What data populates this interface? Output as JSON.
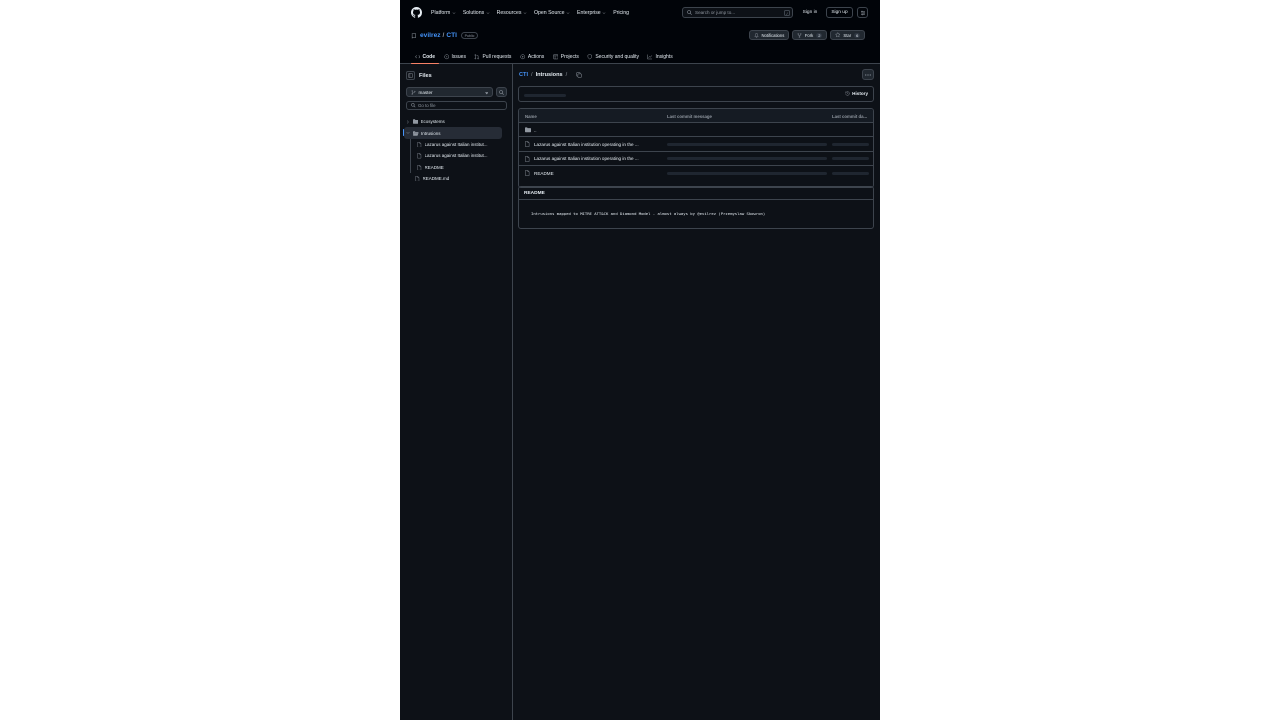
{
  "header": {
    "nav": [
      {
        "label": "Platform",
        "has_menu": true
      },
      {
        "label": "Solutions",
        "has_menu": true
      },
      {
        "label": "Resources",
        "has_menu": true
      },
      {
        "label": "Open Source",
        "has_menu": true
      },
      {
        "label": "Enterprise",
        "has_menu": true
      },
      {
        "label": "Pricing",
        "has_menu": false
      }
    ],
    "search_placeholder": "Search or jump to...",
    "search_shortcut": "/",
    "sign_in": "Sign in",
    "sign_up": "Sign up"
  },
  "repo": {
    "owner": "evilrez",
    "separator": "/",
    "name": "CTI",
    "visibility": "Public",
    "notifications_label": "Notifications",
    "fork_label": "Fork",
    "fork_count": "2",
    "star_label": "Star",
    "star_count": "6",
    "tabs": [
      {
        "label": "Code",
        "icon": "code-icon",
        "active": true
      },
      {
        "label": "Issues",
        "icon": "issue-icon",
        "active": false
      },
      {
        "label": "Pull requests",
        "icon": "pull-request-icon",
        "active": false
      },
      {
        "label": "Actions",
        "icon": "play-icon",
        "active": false
      },
      {
        "label": "Projects",
        "icon": "table-icon",
        "active": false
      },
      {
        "label": "Security and quality",
        "icon": "shield-icon",
        "active": false
      },
      {
        "label": "Insights",
        "icon": "graph-icon",
        "active": false
      }
    ]
  },
  "sidebar": {
    "title": "Files",
    "branch": "master",
    "goto_placeholder": "Go to file",
    "tree": [
      {
        "label": "Ecosystems",
        "type": "folder",
        "depth": 0,
        "expanded": false,
        "selected": false
      },
      {
        "label": "Intrusions",
        "type": "folder",
        "depth": 0,
        "expanded": true,
        "selected": true
      },
      {
        "label": "Lazarus against Italian institut...",
        "type": "file",
        "depth": 1,
        "selected": false
      },
      {
        "label": "Lazarus against Italian institut...",
        "type": "file",
        "depth": 1,
        "selected": false
      },
      {
        "label": "README",
        "type": "file",
        "depth": 1,
        "selected": false
      },
      {
        "label": "README.md",
        "type": "file",
        "depth": 0,
        "selected": false
      }
    ]
  },
  "main": {
    "breadcrumb_root": "CTI",
    "breadcrumb_sep": "/",
    "breadcrumb_current": "Intrusions",
    "breadcrumb_trail": "/",
    "history_label": "History",
    "columns": {
      "name": "Name",
      "message": "Last commit message",
      "date": "Last commit da..."
    },
    "rows": [
      {
        "name": "..",
        "type": "parent"
      },
      {
        "name": "Lazarus against Italian institution operating in the ...",
        "type": "file"
      },
      {
        "name": "Lazarus against Italian institution operating in the ...",
        "type": "file"
      },
      {
        "name": "README",
        "type": "file"
      }
    ],
    "readme_title": "README",
    "readme_text": "Intrusions mapped to MITRE ATT&CK and Diamond Model - almost always by @evilrez (Przemyslaw Skowron)"
  },
  "colors": {
    "page_bg": "#0d1117",
    "header_bg": "#010409",
    "accent_link": "#4493f8",
    "active_tab_underline": "#f78166",
    "border": "#3d444d",
    "muted_text": "#9198a1"
  }
}
